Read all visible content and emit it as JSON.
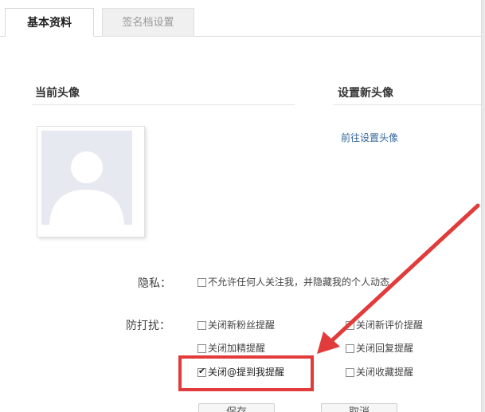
{
  "tabs": [
    {
      "label": "基本资料",
      "active": true
    },
    {
      "label": "签名档设置",
      "active": false
    }
  ],
  "sections": {
    "current_avatar": "当前头像",
    "new_avatar": "设置新头像",
    "set_avatar_link": "前往设置头像"
  },
  "privacy": {
    "label": "隐私：",
    "option": {
      "text": "不允许任何人关注我，并隐藏我的个人动态",
      "checked": false
    }
  },
  "do_not_disturb": {
    "label": "防打扰：",
    "options": [
      {
        "text": "关闭新粉丝提醒",
        "checked": false
      },
      {
        "text": "关闭新评价提醒",
        "checked": false
      },
      {
        "text": "关闭加精提醒",
        "checked": false
      },
      {
        "text": "关闭回复提醒",
        "checked": false
      },
      {
        "text": "关闭@提到我提醒",
        "checked": true
      },
      {
        "text": "关闭收藏提醒",
        "checked": false
      }
    ]
  },
  "buttons": {
    "save": "保存",
    "cancel": "取消"
  },
  "colors": {
    "highlight": "#e23b3b",
    "link": "#336699",
    "avatar_bg": "#e6e9ef"
  }
}
